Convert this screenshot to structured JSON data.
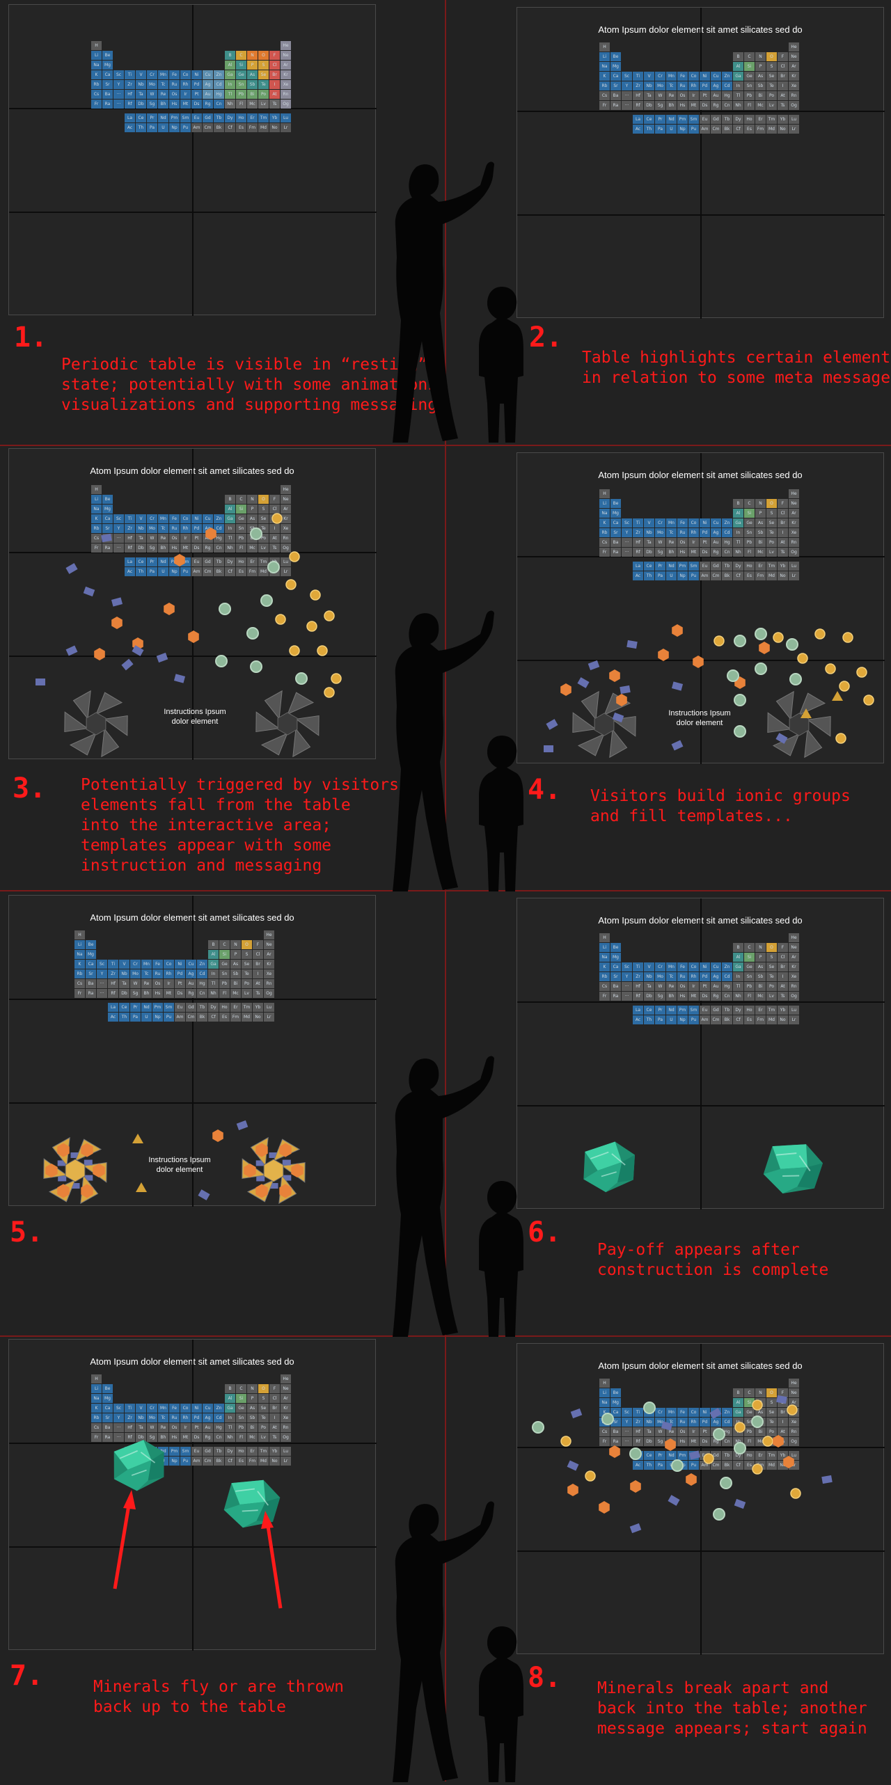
{
  "panels": [
    {
      "number": "1.",
      "headline": "",
      "caption": "Periodic table is visible in “resting”\nstate; potentially with some animations/\nvisualizations and supporting messaging",
      "instruction": ""
    },
    {
      "number": "2.",
      "headline": "Atom Ipsum dolor element sit amet silicates sed do",
      "caption": "Table highlights certain elements\nin relation to some meta message",
      "instruction": ""
    },
    {
      "number": "3.",
      "headline": "Atom Ipsum dolor element sit amet silicates sed do",
      "caption": "Potentially triggered by visitors,\nelements fall from the table\ninto the interactive area;\ntemplates appear with some\ninstruction and messaging",
      "instruction": "Instructions Ipsum\ndolor element"
    },
    {
      "number": "4.",
      "headline": "Atom Ipsum dolor element sit amet silicates sed do",
      "caption": "Visitors build ionic groups\nand fill templates...",
      "instruction": "Instructions Ipsum\ndolor element"
    },
    {
      "number": "5.",
      "headline": "Atom Ipsum dolor element sit amet silicates sed do",
      "caption": "",
      "instruction": "Instructions Ipsum\ndolor element"
    },
    {
      "number": "6.",
      "headline": "Atom Ipsum dolor element sit amet silicates sed do",
      "caption": "Pay-off appears after\nconstruction is complete",
      "instruction": ""
    },
    {
      "number": "7.",
      "headline": "Atom Ipsum dolor element sit amet silicates sed do",
      "caption": "Minerals fly or are thrown\nback up to the table",
      "instruction": ""
    },
    {
      "number": "8.",
      "headline": "Atom Ipsum dolor element sit amet silicates sed do",
      "caption": "Minerals break apart and\nback into the table; another\nmessage appears; start again",
      "instruction": ""
    }
  ],
  "periodic_table": {
    "main_rows": [
      [
        "H",
        "",
        "",
        "",
        "",
        "",
        "",
        "",
        "",
        "",
        "",
        "",
        "",
        "",
        "",
        "",
        "",
        "He"
      ],
      [
        "Li",
        "Be",
        "",
        "",
        "",
        "",
        "",
        "",
        "",
        "",
        "",
        "",
        "B",
        "C",
        "N",
        "O",
        "F",
        "Ne"
      ],
      [
        "Na",
        "Mg",
        "",
        "",
        "",
        "",
        "",
        "",
        "",
        "",
        "",
        "",
        "Al",
        "Si",
        "P",
        "S",
        "Cl",
        "Ar"
      ],
      [
        "K",
        "Ca",
        "Sc",
        "Ti",
        "V",
        "Cr",
        "Mn",
        "Fe",
        "Co",
        "Ni",
        "Cu",
        "Zn",
        "Ga",
        "Ge",
        "As",
        "Se",
        "Br",
        "Kr"
      ],
      [
        "Rb",
        "Sr",
        "Y",
        "Zr",
        "Nb",
        "Mo",
        "Tc",
        "Ru",
        "Rh",
        "Pd",
        "Ag",
        "Cd",
        "In",
        "Sn",
        "Sb",
        "Te",
        "I",
        "Xe"
      ],
      [
        "Cs",
        "Ba",
        "···",
        "Hf",
        "Ta",
        "W",
        "Re",
        "Os",
        "Ir",
        "Pt",
        "Au",
        "Hg",
        "Tl",
        "Pb",
        "Bi",
        "Po",
        "At",
        "Rn"
      ],
      [
        "Fr",
        "Ra",
        "···",
        "Rf",
        "Db",
        "Sg",
        "Bh",
        "Hs",
        "Mt",
        "Ds",
        "Rg",
        "Cn",
        "Nh",
        "Fl",
        "Mc",
        "Lv",
        "Ts",
        "Og"
      ]
    ],
    "f_rows": [
      [
        "La",
        "Ce",
        "Pr",
        "Nd",
        "Pm",
        "Sm",
        "Eu",
        "Gd",
        "Tb",
        "Dy",
        "Ho",
        "Er",
        "Tm",
        "Yb",
        "Lu"
      ],
      [
        "Ac",
        "Th",
        "Pa",
        "U",
        "Np",
        "Pu",
        "Am",
        "Cm",
        "Bk",
        "Cf",
        "Es",
        "Fm",
        "Md",
        "No",
        "Lr"
      ]
    ]
  },
  "colors": {
    "caption_red": "#ff1a1a",
    "blue_element": "#2d6ca3",
    "teal_element": "#3f8f8a",
    "green_element": "#6aa069",
    "gold_element": "#d4a136",
    "orange_element": "#e07a2e",
    "red_element": "#d0564f",
    "gray_element": "#5a5a5a",
    "silicate_orange": "#e8823a",
    "oxygen_gold": "#e0a83a",
    "cation_green": "#8fb89a",
    "tag_purple": "#6670b0",
    "mineral_green": "#2fbf9a"
  },
  "icons": [
    "person-silhouette-icon",
    "child-silhouette-icon",
    "silicate-template-icon",
    "emerald-mineral-icon",
    "arrow-up-icon"
  ]
}
